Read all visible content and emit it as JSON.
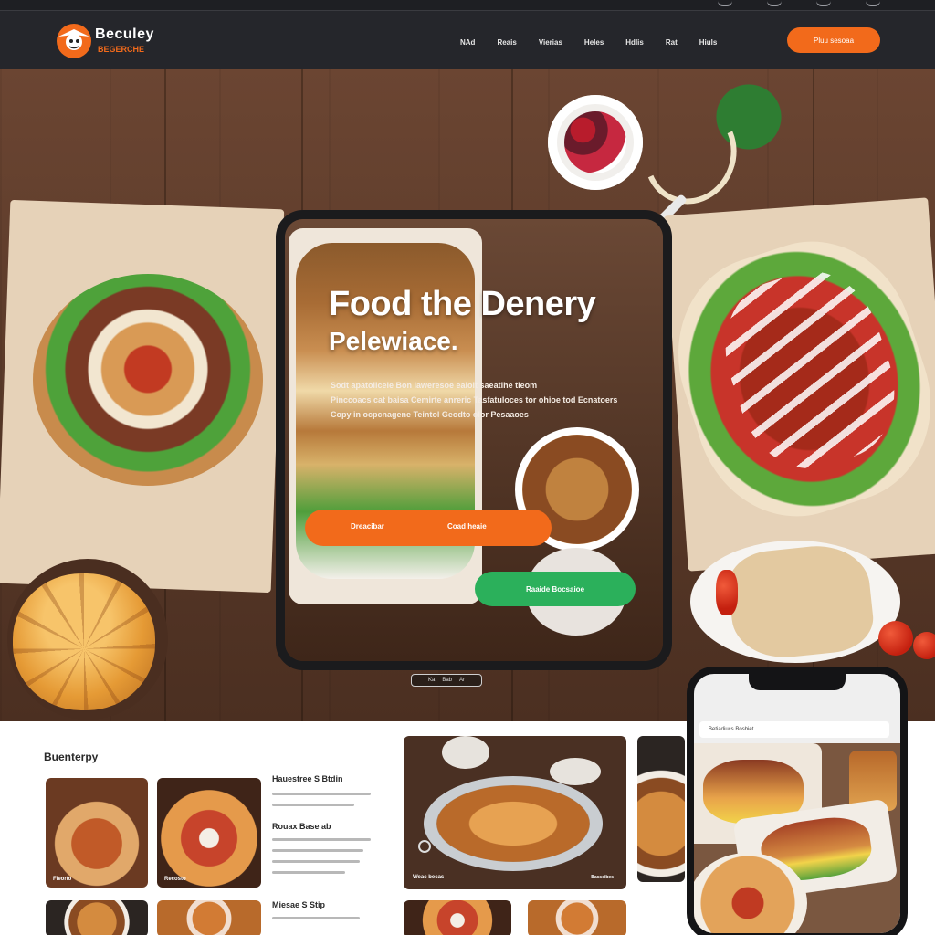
{
  "brand": {
    "name": "Beculey",
    "tagline": "BEGERCHE",
    "colors": {
      "accent": "#f26a1b",
      "green": "#2bb05b",
      "header": "#25262b"
    }
  },
  "nav": {
    "items": [
      "NAd",
      "Reais",
      "Vierias",
      "Heles",
      "Hdlis",
      "Rat",
      "Hiuls"
    ],
    "order_button": "Pluu sesoaa"
  },
  "hero": {
    "title": "Food the Denery",
    "subtitle": "Pelewiace.",
    "body_lines": [
      "Sodt  apatoliceie  Bon laweresoe  ealoit  saeatihe tieom",
      "Pinccoacs  cat baisa  Cemirte  anreric  Tasfatuloces  tor ohioe tod  Ecnatoers",
      "Copy in  ocpcnagene  Teintol  Geodto  olor Pesaaoes"
    ],
    "cta_primary_left": "Dreacibar",
    "cta_primary_right": "Coad heaie",
    "cta_secondary": "Raaide  Bocsaioe",
    "tab_labels": [
      "Ka",
      "Bab",
      "Ar"
    ]
  },
  "gallery": {
    "title": "Buenterpy",
    "cards": [
      {
        "caption": "Fieorto"
      },
      {
        "caption": "Recosto"
      },
      {
        "caption": ""
      },
      {
        "caption": ""
      }
    ],
    "list_headings": [
      "Hauestree S Btdin",
      "Rouax Base ab",
      "Miesae S Stip"
    ],
    "photo_caption_left": "Weac becas",
    "photo_caption_right": "Basseibes"
  },
  "phone": {
    "bar_text": "Betiadiucs  Bosbiet"
  }
}
